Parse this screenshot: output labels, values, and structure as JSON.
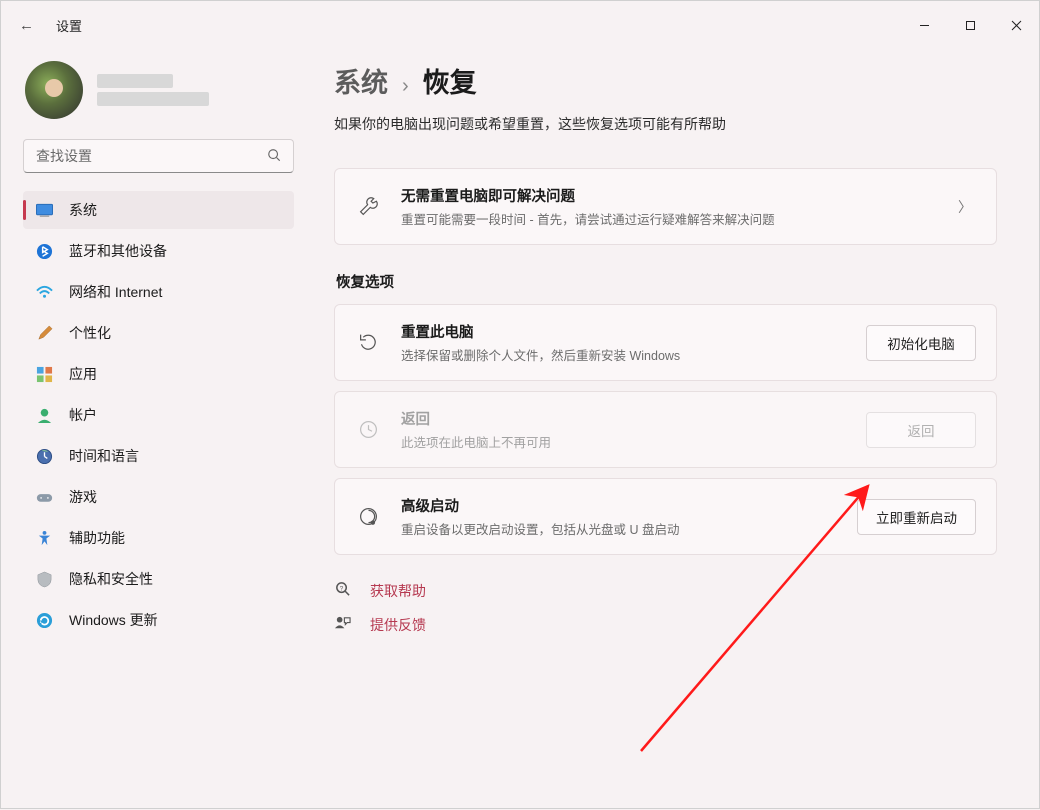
{
  "titlebar": {
    "app_title": "设置"
  },
  "search": {
    "placeholder": "查找设置"
  },
  "sidebar": {
    "items": [
      {
        "label": "系统"
      },
      {
        "label": "蓝牙和其他设备"
      },
      {
        "label": "网络和 Internet"
      },
      {
        "label": "个性化"
      },
      {
        "label": "应用"
      },
      {
        "label": "帐户"
      },
      {
        "label": "时间和语言"
      },
      {
        "label": "游戏"
      },
      {
        "label": "辅助功能"
      },
      {
        "label": "隐私和安全性"
      },
      {
        "label": "Windows 更新"
      }
    ]
  },
  "breadcrumb": {
    "a": "系统",
    "sep": "›",
    "b": "恢复"
  },
  "intro": "如果你的电脑出现问题或希望重置，这些恢复选项可能有所帮助",
  "card_trouble": {
    "title": "无需重置电脑即可解决问题",
    "desc": "重置可能需要一段时间 - 首先，请尝试通过运行疑难解答来解决问题"
  },
  "section_recovery": "恢复选项",
  "card_reset": {
    "title": "重置此电脑",
    "desc": "选择保留或删除个人文件，然后重新安装 Windows",
    "button": "初始化电脑"
  },
  "card_goback": {
    "title": "返回",
    "desc": "此选项在此电脑上不再可用",
    "button": "返回"
  },
  "card_advanced": {
    "title": "高级启动",
    "desc": "重启设备以更改启动设置，包括从光盘或 U 盘启动",
    "button": "立即重新启动"
  },
  "footer": {
    "help": "获取帮助",
    "feedback": "提供反馈"
  }
}
